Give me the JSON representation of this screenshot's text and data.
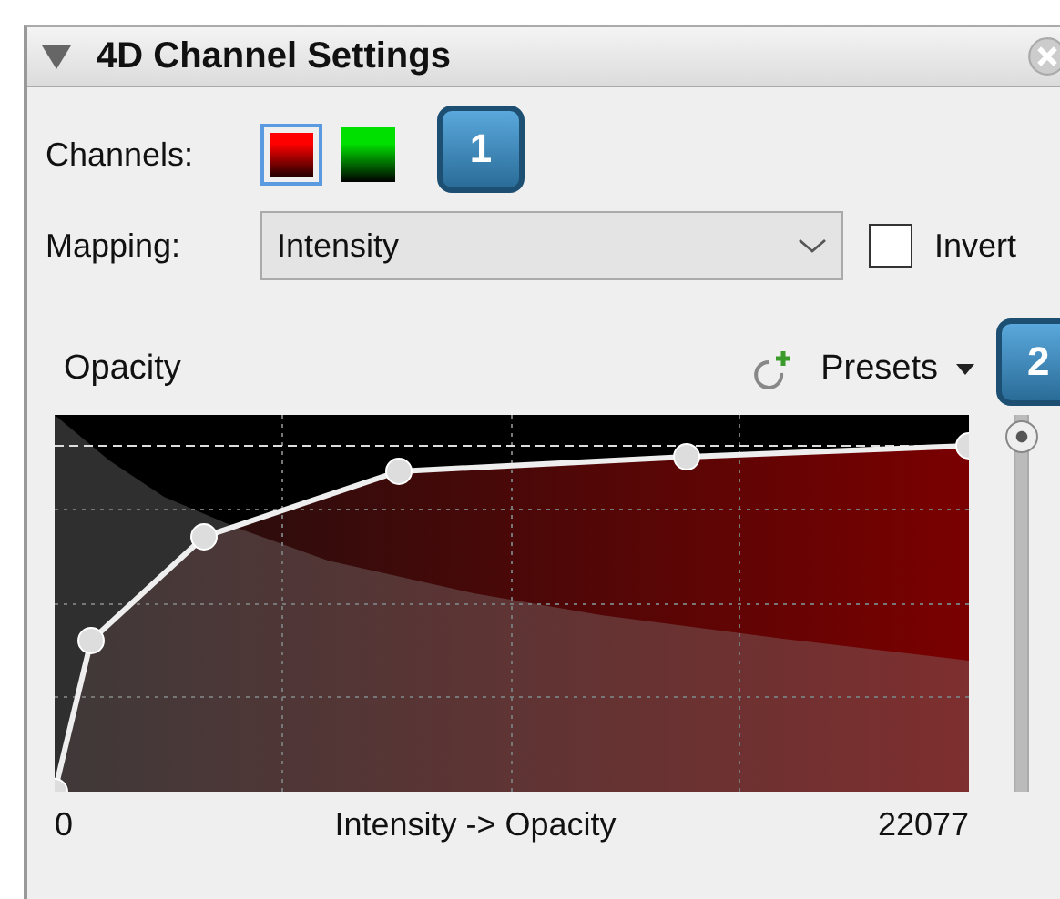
{
  "panel": {
    "title": "4D Channel Settings",
    "expanded": true
  },
  "channels": {
    "label": "Channels:",
    "items": [
      {
        "color": "#ff0000",
        "selected": true
      },
      {
        "color": "#00e000",
        "selected": false
      }
    ]
  },
  "mapping": {
    "label": "Mapping:",
    "value": "Intensity"
  },
  "invert": {
    "label": "Invert",
    "checked": false
  },
  "opacity_editor": {
    "title": "Opacity",
    "presets": "Presets",
    "slider": {
      "level": 0.94
    },
    "axis_min": "0",
    "axis_label": "Intensity -> Opacity",
    "axis_max": "22077"
  },
  "callouts": [
    "1",
    "2"
  ]
}
